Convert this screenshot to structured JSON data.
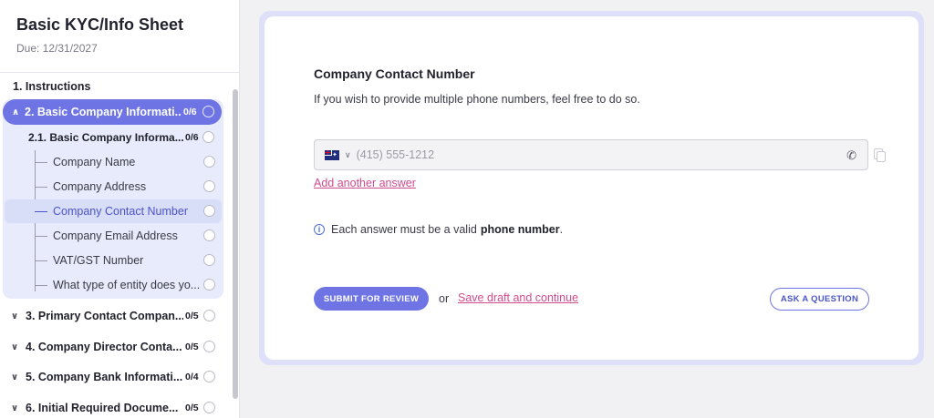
{
  "sheet": {
    "title": "Basic KYC/Info Sheet",
    "due": "Due: 12/31/2027"
  },
  "nav": {
    "instructions": "1. Instructions",
    "active_section": {
      "label": "2. Basic Company Informati...",
      "count": "0/6"
    },
    "subsection": {
      "label": "2.1. Basic Company Informa...",
      "count": "0/6"
    },
    "items": [
      {
        "label": "Company Name"
      },
      {
        "label": "Company Address"
      },
      {
        "label": "Company Contact Number"
      },
      {
        "label": "Company Email Address"
      },
      {
        "label": "VAT/GST Number"
      },
      {
        "label": "What type of entity does yo..."
      }
    ],
    "sections": [
      {
        "label": "3. Primary Contact Compan...",
        "count": "0/5"
      },
      {
        "label": "4. Company Director Conta...",
        "count": "0/5"
      },
      {
        "label": "5. Company Bank Informati...",
        "count": "0/4"
      },
      {
        "label": "6. Initial Required Docume...",
        "count": "0/5"
      }
    ]
  },
  "question": {
    "title": "Company Contact Number",
    "description": "If you wish to provide multiple phone numbers, feel free to do so.",
    "phone_placeholder": "(415) 555-1212",
    "country_flag": "australia-flag",
    "add_answer": "Add another answer",
    "info_prefix": "Each answer must be a valid",
    "info_bold": "phone number",
    "info_suffix": "."
  },
  "actions": {
    "submit": "SUBMIT FOR REVIEW",
    "or": "or",
    "save_draft": "Save draft and continue",
    "ask": "ASK A QUESTION"
  },
  "colors": {
    "accent": "#6e74e4",
    "link": "#d24b8e",
    "active_bg": "#e8ebfb"
  }
}
